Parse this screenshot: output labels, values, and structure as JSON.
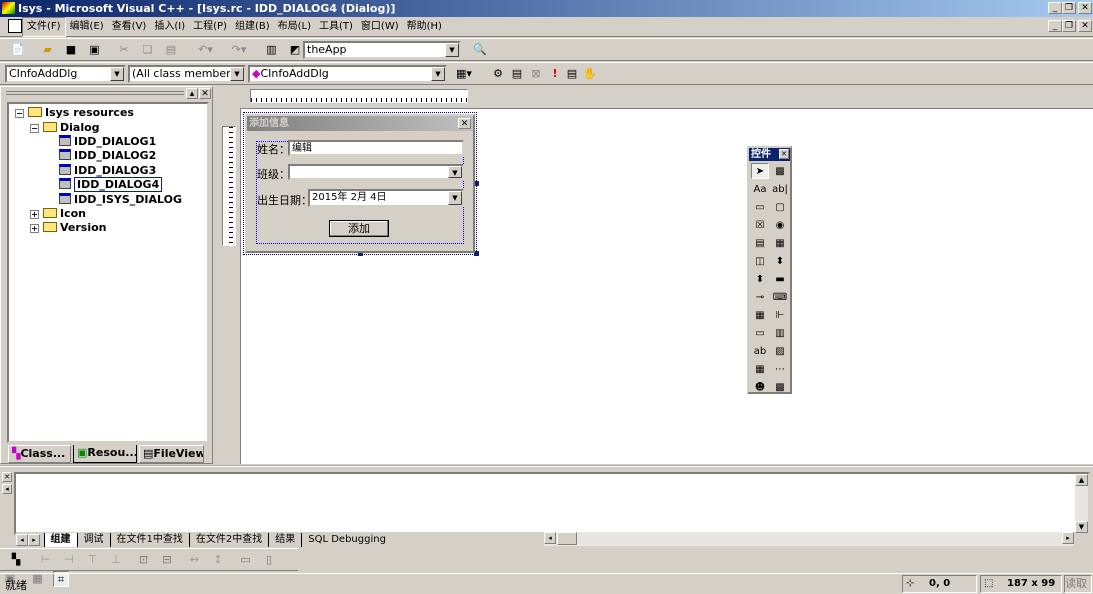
{
  "window": {
    "title": "Isys - Microsoft Visual C++ - [Isys.rc - IDD_DIALOG4 (Dialog)]"
  },
  "menu": [
    "文件(F)",
    "编辑(E)",
    "查看(V)",
    "插入(I)",
    "工程(P)",
    "组建(B)",
    "布局(L)",
    "工具(T)",
    "窗口(W)",
    "帮助(H)"
  ],
  "toolbar": {
    "find_combo": "theApp",
    "class_combo": "CInfoAddDlg",
    "members_combo": "(All class members)",
    "function_combo": "CInfoAddDlg"
  },
  "workspace": {
    "tree": {
      "root": "Isys resources",
      "dialog_folder": "Dialog",
      "dialogs": [
        "IDD_DIALOG1",
        "IDD_DIALOG2",
        "IDD_DIALOG3",
        "IDD_DIALOG4",
        "IDD_ISYS_DIALOG"
      ],
      "selected": "IDD_DIALOG4",
      "icon_folder": "Icon",
      "version_folder": "Version"
    },
    "tabs": [
      "Class...",
      "Resou...",
      "FileView"
    ]
  },
  "dialog": {
    "title": "添加信息",
    "name_label": "姓名：",
    "name_value": "编辑",
    "class_label": "班级：",
    "class_value": "",
    "birth_label": "出生日期：",
    "birth_value": "2015年 2月 4日",
    "add_button": "添加"
  },
  "controls_palette": {
    "title": "控件",
    "icons": [
      "pointer",
      "picture",
      "static-text",
      "edit-box",
      "group-box",
      "button",
      "check-box",
      "radio-button",
      "combo-box",
      "list-box",
      "horizontal-scroll",
      "vertical-scroll",
      "spin",
      "progress",
      "slider",
      "hotkey",
      "list-control",
      "tree-control",
      "tab-control",
      "animate",
      "rich-edit",
      "date-time-picker",
      "month-calendar",
      "ip-address",
      "custom-control",
      "extended-combo"
    ]
  },
  "output": {
    "tabs": [
      "组建",
      "调试",
      "在文件1中查找",
      "在文件2中查找",
      "结果",
      "SQL Debugging"
    ],
    "active_tab": "组建"
  },
  "status": {
    "text": "就绪",
    "position": "0, 0",
    "size": "187 x 99",
    "mode": "读取"
  }
}
